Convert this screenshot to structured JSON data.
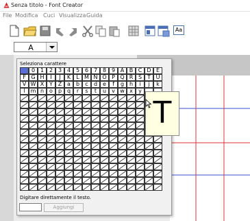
{
  "window": {
    "title": "Senza titolo - Font Creator"
  },
  "menu": [
    {
      "label": "File"
    },
    {
      "label": "Modifica"
    },
    {
      "label": "Cuci"
    },
    {
      "label": "Visualizza"
    },
    {
      "label": "Guida"
    }
  ],
  "toolbar": {
    "icons": [
      "new-document-icon",
      "open-folder-icon",
      "save-icon",
      "undo-icon",
      "redo-icon",
      "cut-icon",
      "copy-icon",
      "paste-icon",
      "grid-icon",
      "view-icon",
      "export-icon",
      "font-aa-icon"
    ],
    "aa_label": "Aa"
  },
  "char_selector": {
    "value": "A"
  },
  "char_popup": {
    "title": "Seleziona carattere",
    "rows": [
      [
        "",
        "0",
        "1",
        "2",
        "3",
        "4",
        "5",
        "6",
        "7",
        "8",
        "9",
        "A",
        "B",
        "C",
        "D",
        "E"
      ],
      [
        "F",
        "G",
        "H",
        "I",
        "J",
        "K",
        "L",
        "M",
        "N",
        "O",
        "P",
        "Q",
        "R",
        "S",
        "T",
        "U"
      ],
      [
        "V",
        "W",
        "X",
        "Y",
        "Z",
        "a",
        "b",
        "c",
        "d",
        "e",
        "f",
        "g",
        "h",
        "i",
        "j",
        "k"
      ],
      [
        "l",
        "m",
        "n",
        "o",
        "p",
        "q",
        "r",
        "s",
        "t",
        "u",
        "v",
        "w",
        "x",
        "y",
        "",
        ""
      ]
    ],
    "empty_rows": 14,
    "selected_index": 0,
    "hint": "Digitare direttamente il testo.",
    "input_value": "",
    "add_button": "Aggiungi"
  },
  "preview": {
    "glyph": "T"
  },
  "colors": {
    "selected_cell": "#5a6fd6",
    "guide_red": "#e0303a",
    "guide_blue": "#3a4fd0",
    "tooltip_bg": "#ffffe2"
  }
}
